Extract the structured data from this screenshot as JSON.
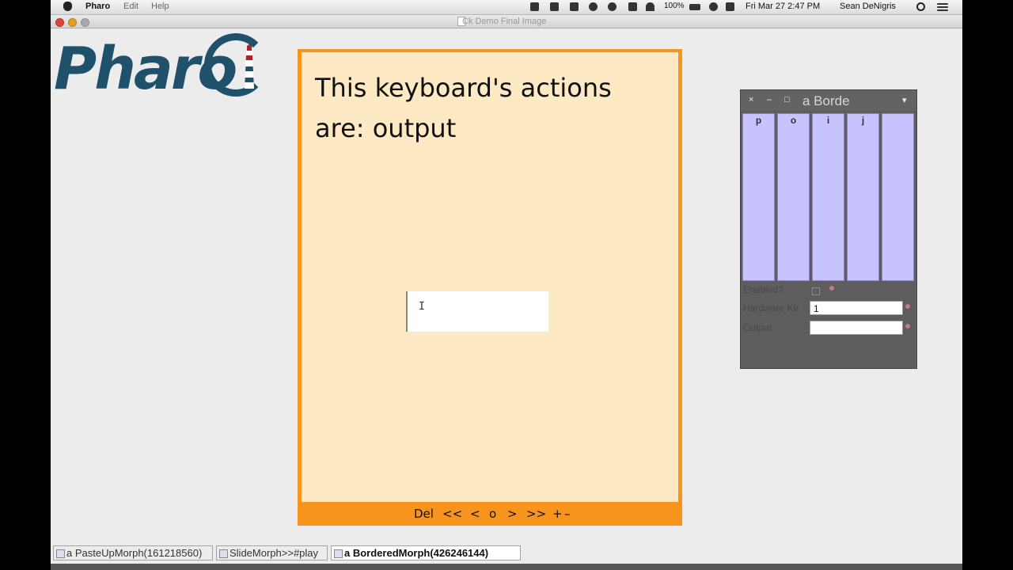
{
  "menubar": {
    "app_name": "Pharo",
    "menus": [
      "Edit",
      "Help"
    ],
    "battery": "100%",
    "clock": "Fri Mar 27  2:47 PM",
    "user": "Sean DeNigris"
  },
  "window": {
    "title": "Ck Demo Final Image"
  },
  "logo": {
    "text": "Pharo"
  },
  "slide": {
    "text": "This keyboard's actions are: output",
    "input_value": "I",
    "nav": [
      "Del",
      "<<",
      "<",
      "o",
      ">",
      ">>",
      "+",
      "–"
    ]
  },
  "keyboard_morph": {
    "title": "a Borde",
    "close_glyph": "×",
    "minimize_glyph": "–",
    "expand_glyph": "□",
    "menu_glyph": "▾",
    "keys": [
      "p",
      "o",
      "i",
      "j",
      ""
    ],
    "enabled_label": "Enabled?",
    "hardware_label": "Hardware Ke",
    "hardware_value": "1",
    "output_label": "Output",
    "output_value": ""
  },
  "taskbar": {
    "items": [
      {
        "label": "a PasteUpMorph(161218560)",
        "active": false
      },
      {
        "label": "SlideMorph>>#play",
        "active": false
      },
      {
        "label": "a BorderedMorph(426246144)",
        "active": true
      }
    ]
  },
  "colors": {
    "slide_border": "#f7941e",
    "slide_background": "#fde9c4",
    "key_color": "#c7c3ff",
    "logo_color": "#20516b"
  }
}
